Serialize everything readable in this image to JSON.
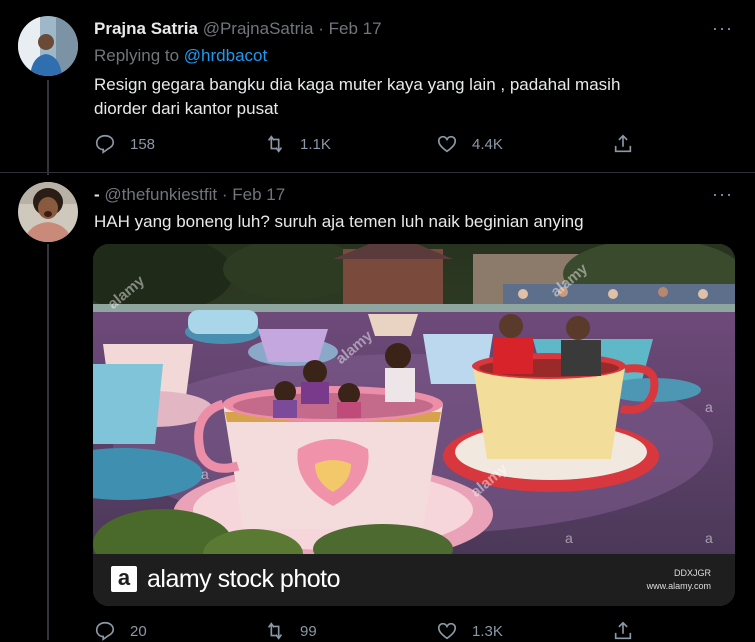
{
  "tweets": [
    {
      "name": "Prajna Satria",
      "handle": "@PrajnaSatria",
      "date": "Feb 17",
      "replying_label": "Replying to",
      "replying_handle": "@hrdbacot",
      "text_line1": "Resign gegara bangku dia kaga muter kaya yang lain , padahal masih",
      "text_line2": "diorder dari kantor pusat",
      "replies": "158",
      "retweets": "1.1K",
      "likes": "4.4K"
    },
    {
      "name": "-",
      "handle": "@thefunkiestfit",
      "date": "Feb 17",
      "text": "HAH yang boneng luh? suruh aja temen luh naik beginian anying",
      "replies": "20",
      "retweets": "99",
      "likes": "1.3K"
    }
  ],
  "media": {
    "brand_text": "alamy stock photo",
    "brand_logo": "a",
    "code": "DDXJGR",
    "site": "www.alamy.com",
    "watermark": "alamy",
    "watermark_small": "a"
  },
  "ui": {
    "more_glyph": "···",
    "separator": "·"
  },
  "icons": [
    "reply-icon",
    "retweet-icon",
    "like-icon",
    "share-icon",
    "more-icon"
  ],
  "colors": {
    "background": "#000000",
    "link": "#1d9bf0",
    "muted": "#71767b",
    "text": "#e7e9ea"
  }
}
